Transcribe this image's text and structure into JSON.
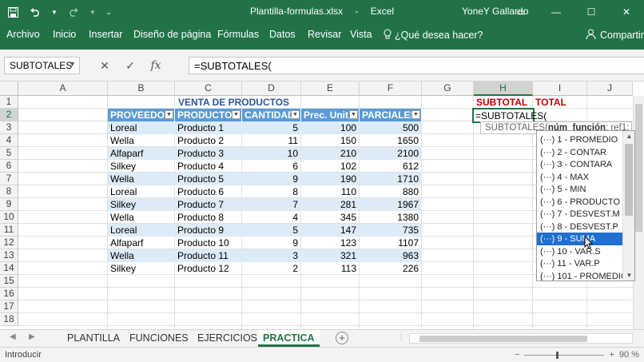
{
  "window": {
    "title": "Plantilla-formulas.xlsx",
    "app": "Excel",
    "user": "YoneY Gallardo",
    "buttons": {
      "restore": "▭",
      "minimize": "—",
      "maximize": "☐",
      "close": "✕"
    }
  },
  "ribbon": {
    "tabs": [
      "Archivo",
      "Inicio",
      "Insertar",
      "Diseño de página",
      "Fórmulas",
      "Datos",
      "Revisar",
      "Vista"
    ],
    "tell_me": "¿Qué desea hacer?",
    "share": "Compartir"
  },
  "formula_bar": {
    "name_box": "SUBTOTALES",
    "formula": "=SUBTOTALES("
  },
  "grid": {
    "columns": [
      "A",
      "B",
      "C",
      "D",
      "E",
      "F",
      "G",
      "H",
      "I",
      "J"
    ],
    "rows": [
      "1",
      "2",
      "3",
      "4",
      "5",
      "6",
      "7",
      "8",
      "9",
      "10",
      "11",
      "12",
      "13",
      "14",
      "15",
      "16",
      "17",
      "18"
    ],
    "selected_column": "H",
    "selected_row": "2"
  },
  "table": {
    "title": "VENTA DE PRODUCTOS",
    "headers": [
      "PROVEEDOR",
      "PRODUCTOS",
      "CANTIDAD",
      "Prec. Unit.",
      "PARCIALES"
    ],
    "rows": [
      [
        "Loreal",
        "Producto 1",
        "5",
        "100",
        "500"
      ],
      [
        "Wella",
        "Producto 2",
        "11",
        "150",
        "1650"
      ],
      [
        "Alfaparf",
        "Producto 3",
        "10",
        "210",
        "2100"
      ],
      [
        "Silkey",
        "Producto 4",
        "6",
        "102",
        "612"
      ],
      [
        "Wella",
        "Producto 5",
        "9",
        "190",
        "1710"
      ],
      [
        "Loreal",
        "Producto 6",
        "8",
        "110",
        "880"
      ],
      [
        "Silkey",
        "Producto 7",
        "7",
        "281",
        "1967"
      ],
      [
        "Wella",
        "Producto 8",
        "4",
        "345",
        "1380"
      ],
      [
        "Loreal",
        "Producto 9",
        "5",
        "147",
        "735"
      ],
      [
        "Alfaparf",
        "Producto 10",
        "9",
        "123",
        "1107"
      ],
      [
        "Wella",
        "Producto 11",
        "3",
        "321",
        "963"
      ],
      [
        "Silkey",
        "Producto 12",
        "2",
        "113",
        "226"
      ]
    ]
  },
  "side_labels": {
    "subtotal": "SUBTOTAL",
    "total": "TOTAL"
  },
  "active_cell_text": "=SUBTOTALES(",
  "tooltip": {
    "func": "SUBTOTALES(",
    "arg1": "núm_función",
    "rest": "; ref1; ...)"
  },
  "function_list": [
    "(···) 1 - PROMEDIO",
    "(···) 2 - CONTAR",
    "(···) 3 - CONTARA",
    "(···) 4 - MAX",
    "(···) 5 - MIN",
    "(···) 6 - PRODUCTO",
    "(···) 7 - DESVEST.M",
    "(···) 8 - DESVEST.P",
    "(···) 9 - SUMA",
    "(···) 10 - VAR.S",
    "(···) 11 - VAR.P",
    "(···) 101 - PROMEDIO"
  ],
  "function_list_selected": 8,
  "sheets": [
    "PLANTILLA",
    "FUNCIONES",
    "EJERCICIOS",
    "PRACTICA"
  ],
  "active_sheet": "PRACTICA",
  "status": {
    "mode": "Introducir",
    "zoom": "90 %",
    "zoom_minus": "−",
    "zoom_plus": "+"
  },
  "colors": {
    "accent": "#217346",
    "table_header": "#5b9bd5",
    "band": "#ddebf7",
    "title": "#2f5597",
    "red": "#c00000",
    "list_selected": "#1e6fd0"
  }
}
